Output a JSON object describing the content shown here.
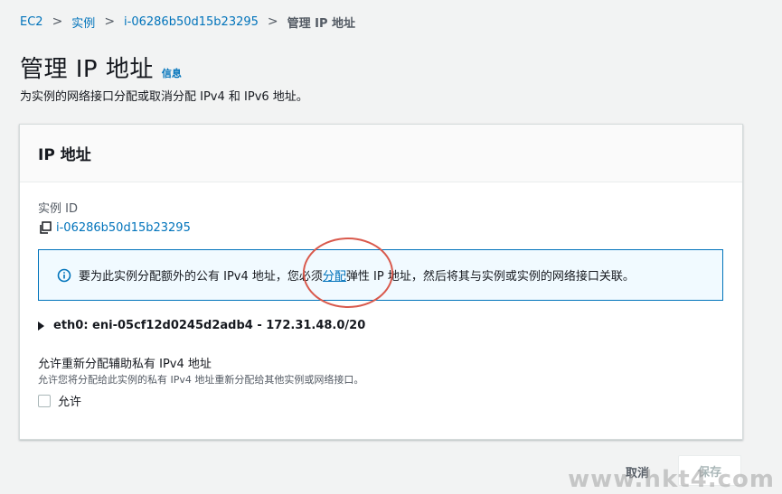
{
  "breadcrumb": {
    "items": [
      "EC2",
      "实例",
      "i-06286b50d15b23295",
      "管理 IP 地址"
    ],
    "separator": ">"
  },
  "header": {
    "title": "管理 IP 地址",
    "info_link": "信息",
    "description": "为实例的网络接口分配或取消分配 IPv4 和 IPv6 地址。"
  },
  "panel": {
    "title": "IP 地址",
    "instance_label": "实例 ID",
    "instance_id": "i-06286b50d15b23295",
    "alert": {
      "text_before": "要为此实例分配额外的公有 IPv4 地址，您必须",
      "link": "分配",
      "text_after": "弹性 IP 地址，然后将其与实例或实例的网络接口关联。"
    },
    "eth_interface": "eth0: eni-05cf12d0245d2adb4 - 172.31.48.0/20",
    "reassign": {
      "title": "允许重新分配辅助私有 IPv4 地址",
      "description": "允许您将分配给此实例的私有 IPv4 地址重新分配给其他实例或网络接口。",
      "checkbox_label": "允许"
    }
  },
  "footer": {
    "cancel_label": "取消",
    "save_label": "保存"
  },
  "watermark": "www.hkt4.com",
  "colors": {
    "link": "#0073bb",
    "alert_bg": "#f1faff",
    "annotation": "#d9594c"
  }
}
